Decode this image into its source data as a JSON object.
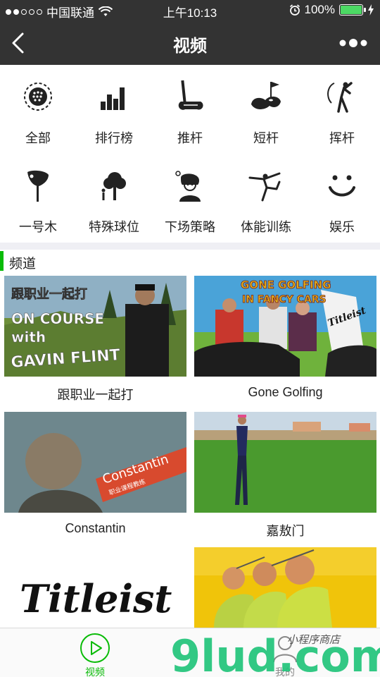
{
  "status_bar": {
    "carrier": "中国联通",
    "time": "上午10:13",
    "battery_text": "100%",
    "battery_level": 1.0,
    "signal_bars_filled": 2,
    "signal_bars_total": 5
  },
  "nav": {
    "title": "视频",
    "back_icon": "chevron-left-icon",
    "more_icon": "more-dots-icon"
  },
  "categories": [
    {
      "label": "全部",
      "icon": "golf-ball-icon"
    },
    {
      "label": "排行榜",
      "icon": "bar-chart-icon"
    },
    {
      "label": "推杆",
      "icon": "putter-icon"
    },
    {
      "label": "短杆",
      "icon": "green-flag-icon"
    },
    {
      "label": "挥杆",
      "icon": "golfer-swing-icon"
    },
    {
      "label": "一号木",
      "icon": "driver-icon"
    },
    {
      "label": "特殊球位",
      "icon": "tree-golfer-icon"
    },
    {
      "label": "下场策略",
      "icon": "thinking-person-icon"
    },
    {
      "label": "体能训练",
      "icon": "yoga-pose-icon"
    },
    {
      "label": "娱乐",
      "icon": "smile-icon"
    }
  ],
  "channels": {
    "heading": "频道",
    "accent": "#09bb07",
    "items": [
      {
        "caption": "跟职业一起打",
        "thumb_lines": [
          "跟职业一起打",
          "ON COURSE",
          "with",
          "GAVIN FLINT"
        ]
      },
      {
        "caption": "Gone Golfing",
        "thumb_lines": [
          "GONE GOLFING",
          "IN FANCY CARS",
          "Titleist"
        ]
      },
      {
        "caption": "Constantin",
        "thumb_lines": [
          "Constantin",
          "职业课程教练"
        ]
      },
      {
        "caption": "嘉敖门",
        "thumb_lines": []
      },
      {
        "caption": "",
        "thumb_lines": [
          "Titleist"
        ]
      },
      {
        "caption": "",
        "thumb_lines": []
      }
    ]
  },
  "tabbar": {
    "tabs": [
      {
        "label": "视频",
        "icon": "play-circle-icon",
        "active": true
      },
      {
        "label": "我的",
        "icon": "user-icon",
        "active": false
      }
    ],
    "active_color": "#09bb07"
  },
  "watermark": {
    "logo_text": "9lud.com",
    "slogan": "小程序商店"
  }
}
